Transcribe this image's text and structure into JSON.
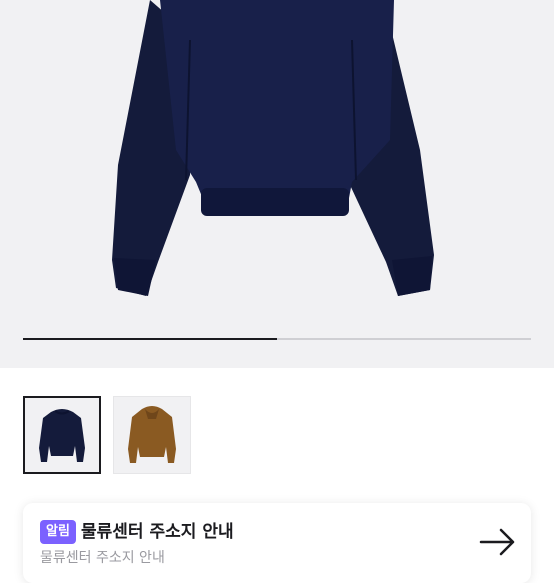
{
  "product_gallery": {
    "images": [
      {
        "color": "navy",
        "icon": "navy-hoodie-image"
      },
      {
        "color": "brown",
        "icon": "brown-hoodie-image"
      }
    ],
    "selected_index": 0,
    "slide_progress": 0.5
  },
  "notice": {
    "badge": "알림",
    "title": "물류센터 주소지 안내",
    "subtitle": "물류센터 주소지 안내",
    "action_icon": "arrow-right-icon"
  },
  "colors": {
    "navy": "#141b3b",
    "brown": "#8a5a22",
    "accent": "#7b61ff",
    "text": "#1b1b1f"
  }
}
